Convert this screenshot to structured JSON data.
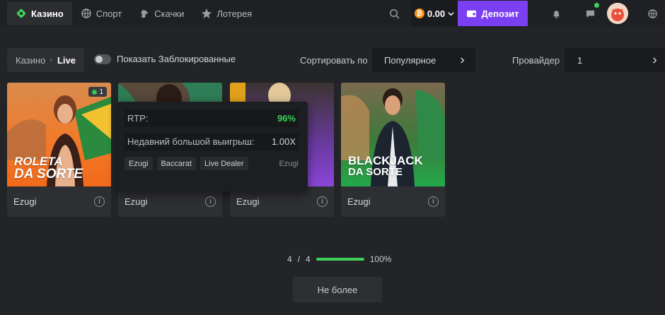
{
  "nav": {
    "items": [
      {
        "label": "Казино",
        "icon": "casino-icon",
        "active": true
      },
      {
        "label": "Спорт",
        "icon": "sport-icon",
        "active": false
      },
      {
        "label": "Скачки",
        "icon": "horse-icon",
        "active": false
      },
      {
        "label": "Лотерея",
        "icon": "lottery-icon",
        "active": false
      }
    ]
  },
  "header": {
    "balance": "0.00",
    "currency_symbol": "₿",
    "deposit_label": "Депозит",
    "accent_color": "#7b3ff2"
  },
  "filters": {
    "breadcrumb_root": "Казино",
    "breadcrumb_current": "Live",
    "toggle_label": "Показать Заблокированные",
    "sort_label": "Сортировать по",
    "sort_value": "Популярное",
    "provider_label": "Провайдер",
    "provider_value": "1"
  },
  "games": [
    {
      "provider": "Ezugi",
      "title_line1": "ROLETA",
      "title_line2": "DA SORTE",
      "badge_count": "1"
    },
    {
      "provider": "Ezugi"
    },
    {
      "provider": "Ezugi"
    },
    {
      "provider": "Ezugi",
      "title_line1": "BLACKJACK",
      "title_line2": "DA SORTE"
    }
  ],
  "tooltip": {
    "rtp_label": "RTP:",
    "rtp_value": "96%",
    "bigwin_label": "Недавний большой выигрыш:",
    "bigwin_value": "1.00X",
    "tags": [
      "Ezugi",
      "Baccarat",
      "Live Dealer"
    ],
    "provider": "Ezugi"
  },
  "pagination": {
    "shown": "4",
    "separator": "/",
    "total": "4",
    "percent_label": "100%",
    "progress": 1.0,
    "more_label": "Не более"
  }
}
